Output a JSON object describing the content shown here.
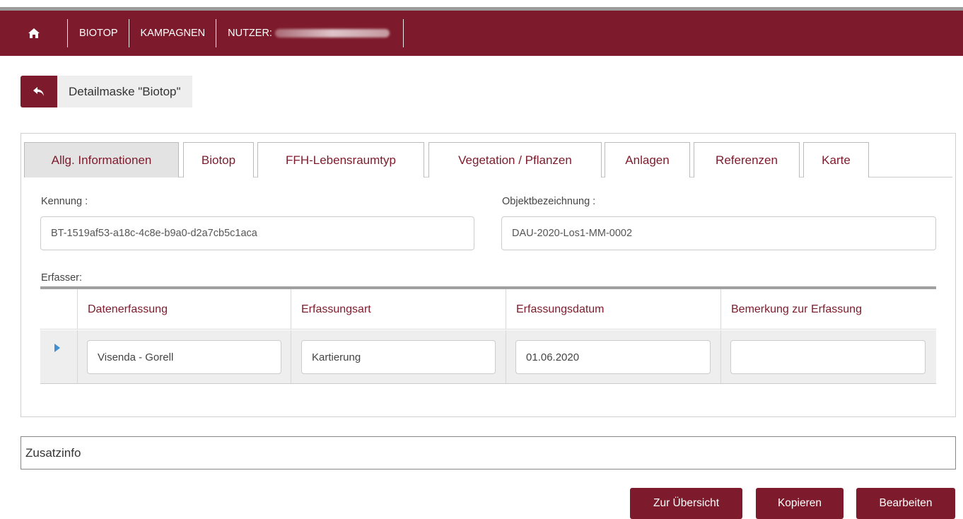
{
  "nav": {
    "home_icon": "home-icon",
    "items": [
      "BIOTOP",
      "KAMPAGNEN"
    ],
    "user_label": "NUTZER:"
  },
  "header": {
    "back_icon": "reply-arrow-icon",
    "title": "Detailmaske \"Biotop\""
  },
  "tabs": [
    {
      "label": "Allg. Informationen",
      "active": true
    },
    {
      "label": "Biotop",
      "active": false
    },
    {
      "label": "FFH-Lebensraumtyp",
      "active": false
    },
    {
      "label": "Vegetation / Pflanzen",
      "active": false
    },
    {
      "label": "Anlagen",
      "active": false
    },
    {
      "label": "Referenzen",
      "active": false
    },
    {
      "label": "Karte",
      "active": false
    }
  ],
  "form": {
    "kennung_label": "Kennung :",
    "kennung_value": "BT-1519af53-a18c-4c8e-b9a0-d2a7cb5c1aca",
    "objekt_label": "Objektbezeichnung :",
    "objekt_value": "DAU-2020-Los1-MM-0002",
    "erfasser_label": "Erfasser:"
  },
  "grid": {
    "columns": [
      "Datenerfassung",
      "Erfassungsart",
      "Erfassungsdatum",
      "Bemerkung zur Erfassung"
    ],
    "rows": [
      [
        "Visenda - Gorell",
        "Kartierung",
        "01.06.2020",
        ""
      ]
    ]
  },
  "zusatzinfo": "Zusatzinfo",
  "buttons": {
    "overview": "Zur Übersicht",
    "copy": "Kopieren",
    "edit": "Bearbeiten"
  },
  "colors": {
    "brand": "#7d1a2b",
    "row_marker": "#3f8fd2"
  }
}
